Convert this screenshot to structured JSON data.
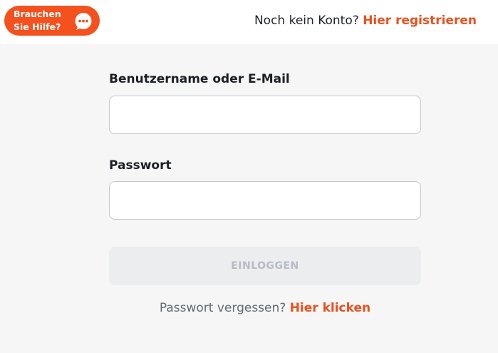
{
  "help": {
    "label": "Brauchen\nSie Hilfe?",
    "icon": "chat-bubble-icon"
  },
  "header": {
    "signup_prompt": "Noch kein Konto?",
    "signup_link": "Hier registrieren"
  },
  "form": {
    "username_label": "Benutzername oder E-Mail",
    "username_value": "",
    "password_label": "Passwort",
    "password_value": "",
    "login_button": "EINLOGGEN",
    "forgot_prompt": "Passwort vergessen?",
    "forgot_link": "Hier klicken"
  },
  "colors": {
    "accent": "#e8501c",
    "help_button_bg": "#f4511e",
    "page_bg": "#f6f6f7",
    "disabled_button_bg": "#ebedef",
    "disabled_button_text": "#b7bcc3"
  }
}
